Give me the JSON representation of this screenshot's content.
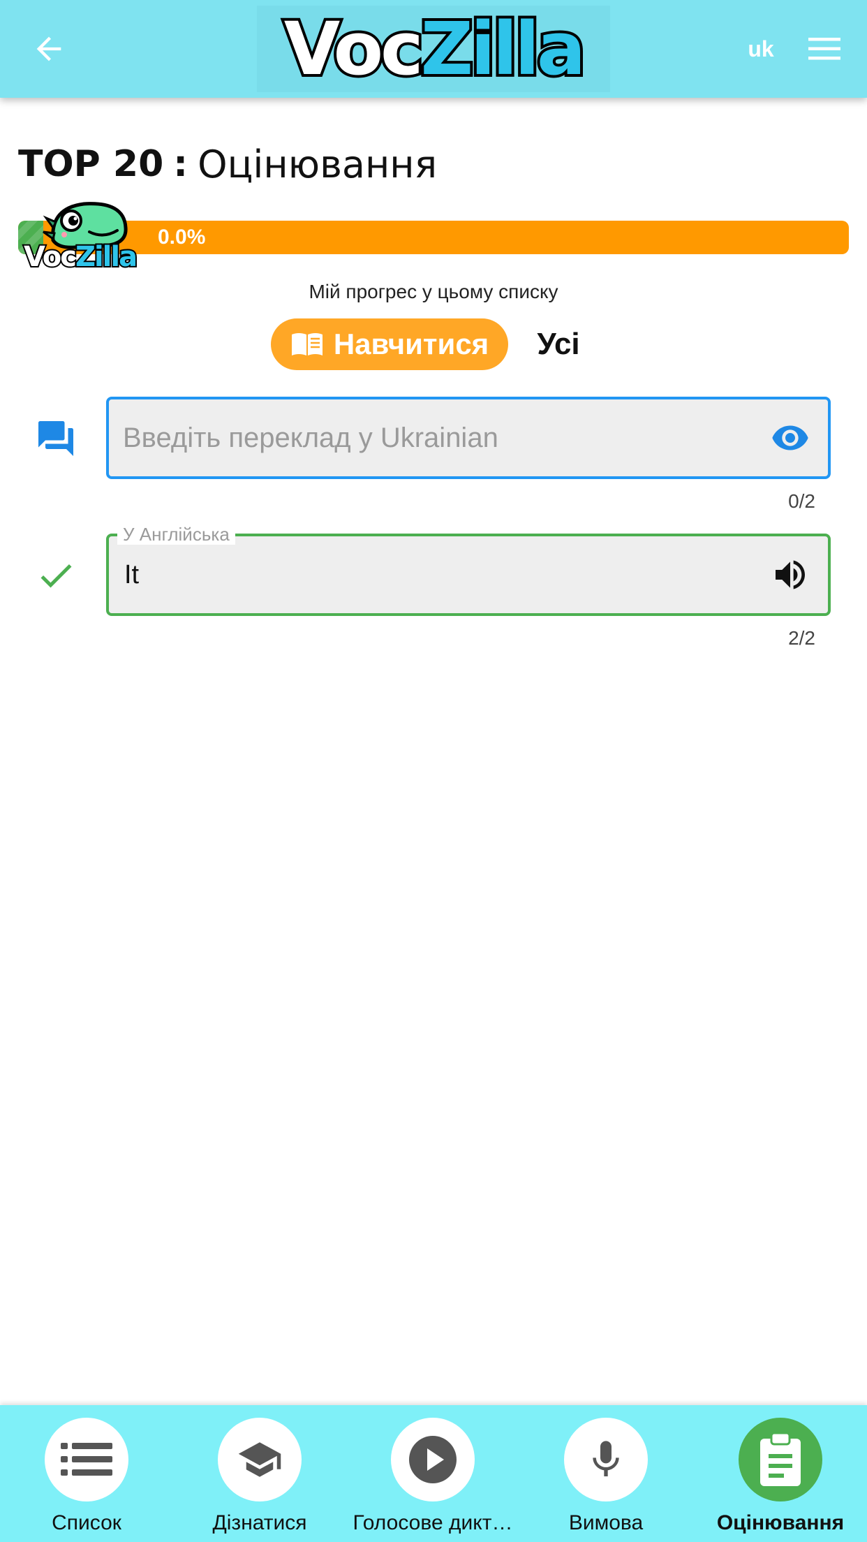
{
  "header": {
    "logo_part1": "Voc",
    "logo_part2": "Zilla",
    "language": "uk",
    "back_icon": "arrow-left-icon",
    "menu_icon": "hamburger-menu-icon"
  },
  "page": {
    "title_bold": "TOP 20",
    "title_separator": ":",
    "title_rest": "Оцінювання"
  },
  "progress": {
    "value_percent": 0.0,
    "label": "0.0%",
    "caption": "Мій прогрес у цьому списку",
    "mascot_part1": "Voc",
    "mascot_part2": "Zilla"
  },
  "mode_toggle": {
    "learn_label": "Навчитися",
    "learn_icon": "open-book-icon",
    "all_label": "Усі"
  },
  "fields": [
    {
      "status_icon": "chat-bubbles-icon",
      "placeholder": "Введіть переклад у Ukrainian",
      "value": "",
      "action_icon": "eye-icon",
      "counter": "0/2"
    },
    {
      "status_icon": "check-icon",
      "label": "У Англійська",
      "value": "It",
      "action_icon": "speaker-icon",
      "counter": "2/2"
    }
  ],
  "bottom_nav": {
    "items": [
      {
        "label": "Список",
        "icon": "list-icon",
        "active": false
      },
      {
        "label": "Дізнатися",
        "icon": "graduation-cap-icon",
        "active": false
      },
      {
        "label": "Голосове дикт…",
        "icon": "play-icon",
        "active": false
      },
      {
        "label": "Вимова",
        "icon": "microphone-icon",
        "active": false
      },
      {
        "label": "Оцінювання",
        "icon": "clipboard-icon",
        "active": true
      }
    ]
  },
  "colors": {
    "header_bg": "#7fe3f0",
    "progress_bar": "#ff9900",
    "learn_button": "#ffa726",
    "field_focus": "#2196f3",
    "field_success": "#4caf50",
    "nav_active": "#4caf50"
  }
}
